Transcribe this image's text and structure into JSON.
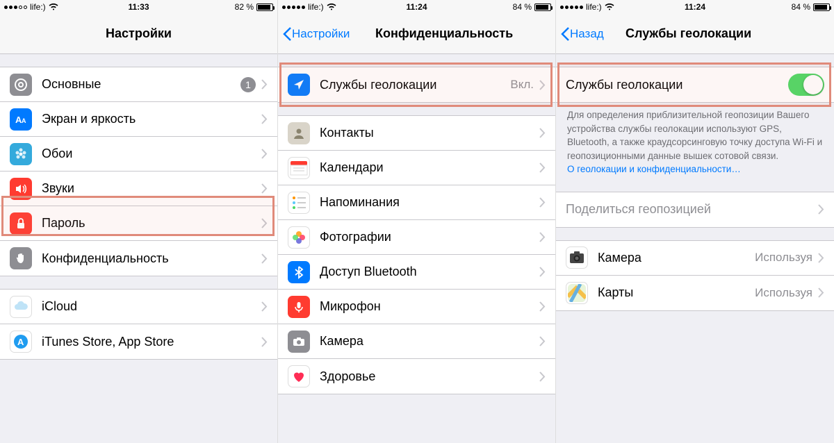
{
  "screen1": {
    "status": {
      "carrier": "life:)",
      "time": "11:33",
      "battery": "82 %"
    },
    "title": "Настройки",
    "rows": {
      "general": {
        "label": "Основные",
        "badge": "1"
      },
      "display": {
        "label": "Экран и яркость"
      },
      "wallpaper": {
        "label": "Обои"
      },
      "sounds": {
        "label": "Звуки"
      },
      "passcode": {
        "label": "Пароль"
      },
      "privacy": {
        "label": "Конфиденциальность"
      },
      "icloud": {
        "label": "iCloud"
      },
      "store": {
        "label": "iTunes Store, App Store"
      }
    }
  },
  "screen2": {
    "status": {
      "carrier": "life:)",
      "time": "11:24",
      "battery": "84 %"
    },
    "back": "Настройки",
    "title": "Конфиденциальность",
    "rows": {
      "location": {
        "label": "Службы геолокации",
        "value": "Вкл."
      },
      "contacts": {
        "label": "Контакты"
      },
      "calendars": {
        "label": "Календари"
      },
      "reminders": {
        "label": "Напоминания"
      },
      "photos": {
        "label": "Фотографии"
      },
      "bluetooth": {
        "label": "Доступ Bluetooth"
      },
      "mic": {
        "label": "Микрофон"
      },
      "camera": {
        "label": "Камера"
      },
      "health": {
        "label": "Здоровье"
      }
    }
  },
  "screen3": {
    "status": {
      "carrier": "life:)",
      "time": "11:24",
      "battery": "84 %"
    },
    "back": "Назад",
    "title": "Службы геолокации",
    "toggle_label": "Службы геолокации",
    "description": "Для определения приблизительной геопозиции Вашего устройства службы геолокации используют GPS, Bluetooth, а также краудсорсинговую точку доступа Wi-Fi и геопозиционными данные вышек сотовой связи.",
    "link": "О геолокации и конфиденциальности…",
    "share_label": "Поделиться геопозицией",
    "apps": {
      "camera": {
        "label": "Камера",
        "value": "Используя"
      },
      "maps": {
        "label": "Карты",
        "value": "Используя"
      }
    }
  }
}
